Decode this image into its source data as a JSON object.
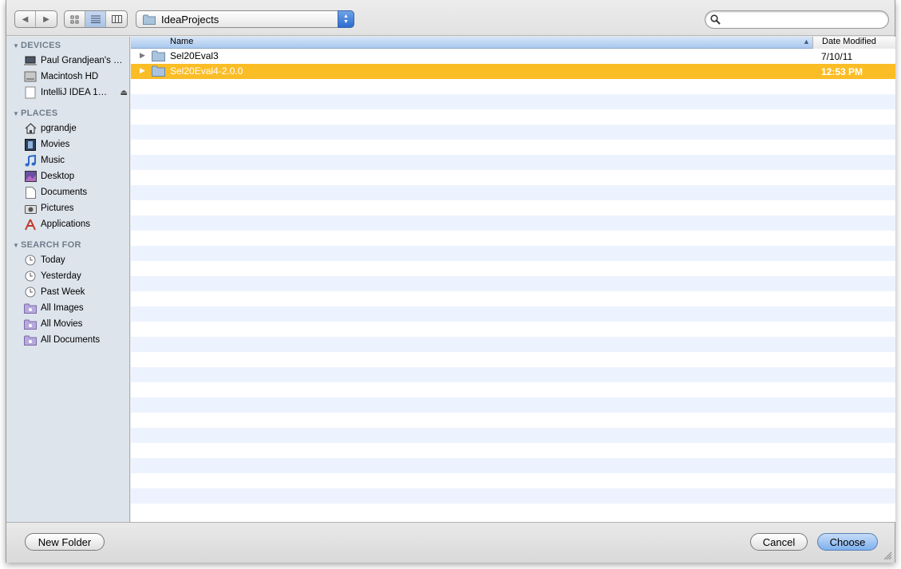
{
  "toolbar": {
    "back_icon": "back-arrow-icon",
    "forward_icon": "forward-arrow-icon",
    "view_modes": [
      "icon-view",
      "list-view",
      "column-view"
    ],
    "active_view": "list-view",
    "path": "IdeaProjects",
    "search": {
      "value": "",
      "placeholder": ""
    }
  },
  "sidebar": {
    "sections": [
      {
        "title": "DEVICES",
        "items": [
          {
            "label": "Paul Grandjean's …",
            "icon": "laptop-icon"
          },
          {
            "label": "Macintosh HD",
            "icon": "harddrive-icon"
          },
          {
            "label": "IntelliJ IDEA 1…",
            "icon": "disk-image-icon",
            "eject": true
          }
        ]
      },
      {
        "title": "PLACES",
        "items": [
          {
            "label": "pgrandje",
            "icon": "home-icon"
          },
          {
            "label": "Movies",
            "icon": "movies-icon"
          },
          {
            "label": "Music",
            "icon": "music-icon"
          },
          {
            "label": "Desktop",
            "icon": "desktop-icon"
          },
          {
            "label": "Documents",
            "icon": "documents-icon"
          },
          {
            "label": "Pictures",
            "icon": "pictures-icon"
          },
          {
            "label": "Applications",
            "icon": "applications-icon"
          }
        ]
      },
      {
        "title": "SEARCH FOR",
        "items": [
          {
            "label": "Today",
            "icon": "clock-icon"
          },
          {
            "label": "Yesterday",
            "icon": "clock-icon"
          },
          {
            "label": "Past Week",
            "icon": "clock-icon"
          },
          {
            "label": "All Images",
            "icon": "smart-folder-icon"
          },
          {
            "label": "All Movies",
            "icon": "smart-folder-icon"
          },
          {
            "label": "All Documents",
            "icon": "smart-folder-icon"
          }
        ]
      }
    ]
  },
  "filelist": {
    "columns": {
      "name": "Name",
      "date": "Date Modified"
    },
    "rows": [
      {
        "name": "Sel20Eval3",
        "date": "7/10/11",
        "selected": false
      },
      {
        "name": "Sel20Eval4-2.0.0",
        "date": "12:53 PM",
        "selected": true
      }
    ]
  },
  "buttons": {
    "new_folder": "New Folder",
    "cancel": "Cancel",
    "choose": "Choose"
  },
  "colors": {
    "selection": "#fbbd26",
    "stripe": "#edf3fe",
    "sidebar_bg": "#dde4ec",
    "default_button": "#7eb0ee"
  }
}
